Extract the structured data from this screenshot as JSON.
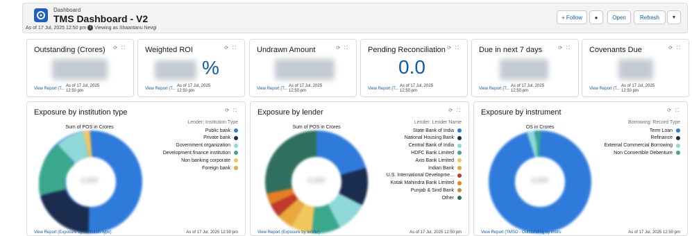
{
  "header": {
    "breadcrumb": "Dashboard",
    "title": "TMS Dashboard - V2",
    "as_of": "As of 17 Jul, 2025 12:50 pm",
    "viewing_as": "Viewing as Shaantanu Nevgi",
    "buttons": {
      "follow": "+ Follow",
      "open": "Open",
      "refresh": "Refresh"
    }
  },
  "kpis": [
    {
      "title": "Outstanding (Crores)",
      "value": "",
      "link": "View Report (T...",
      "as_of": "As of 17 Jul, 2025 12:50 pm"
    },
    {
      "title": "Weighted ROI",
      "value": "%",
      "link": "View Report (T...",
      "as_of": "As of 17 Jul, 2025 12:50 pm"
    },
    {
      "title": "Undrawn Amount",
      "value": "",
      "link": "View Report (T...",
      "as_of": "As of 17 Jul, 2025 12:50 pm"
    },
    {
      "title": "Pending Reconciliation",
      "value": "0.0",
      "link": "View Report (T...",
      "as_of": "As of 17 Jul, 2025 12:50 pm"
    },
    {
      "title": "Due in next 7 days",
      "value": "",
      "link": "View Report (T...",
      "as_of": "As of 17 Jul, 2025 12:50 pm"
    },
    {
      "title": "Covenants Due",
      "value": "",
      "link": "View Report (T...",
      "as_of": "As of 17 Jul, 2025 12:50 pm"
    }
  ],
  "charts": [
    {
      "title": "Exposure by institution type",
      "measure_label": "Sum of POS in Crores",
      "legend_title": "Lender: Institution Type",
      "legend": [
        {
          "label": "Public bank",
          "color": "#2e7bdc"
        },
        {
          "label": "Private bank",
          "color": "#1b2d4f"
        },
        {
          "label": "Government organization",
          "color": "#8fd8d8"
        },
        {
          "label": "Development finance institution",
          "color": "#3aa88c"
        },
        {
          "label": "Non banking corporate",
          "color": "#f2c75c"
        },
        {
          "label": "Foreign bank",
          "color": "#e8a83c"
        }
      ],
      "footer_link": "View Report (Exposure by institution type)",
      "footer_asof": "As of 17 Jul, 2025 12:50 pm"
    },
    {
      "title": "Exposure by lender",
      "measure_label": "Sum of POS in Crores",
      "legend_title": "Lender: Lender Name",
      "legend": [
        {
          "label": "State Bank of India",
          "color": "#2e7bdc"
        },
        {
          "label": "National Housing Bank",
          "color": "#1b2d4f"
        },
        {
          "label": "Central Bank of India",
          "color": "#8fd8d8"
        },
        {
          "label": "HDFC Bank Limited",
          "color": "#3aa88c"
        },
        {
          "label": "Axis Bank Limited",
          "color": "#f2c75c"
        },
        {
          "label": "Indian Bank",
          "color": "#e8a83c"
        },
        {
          "label": "U.S. International Developme...",
          "color": "#c0392b"
        },
        {
          "label": "Kotak Mahindra Bank Limited",
          "color": "#e67e22"
        },
        {
          "label": "Punjab & Sind Bank",
          "color": "#c58a3a"
        },
        {
          "label": "Other",
          "color": "#2f6f5e"
        }
      ],
      "footer_link": "View Report (Exposure by lender)",
      "footer_asof": "As of 17 Jul, 2025 12:50 pm"
    },
    {
      "title": "Exposure by instrument",
      "measure_label": "OS in Crores",
      "legend_title": "Borrowing: Record Type",
      "legend": [
        {
          "label": "Term Loan",
          "color": "#2e7bdc"
        },
        {
          "label": "Refinance",
          "color": "#1b2d4f"
        },
        {
          "label": "External Commercial Borrowing",
          "color": "#8fd8d8"
        },
        {
          "label": "Non Convertible Debenture",
          "color": "#3aa88c"
        }
      ],
      "footer_link": "View Report (TMSO - Outstanding by instru",
      "footer_asof": "As of 17 Jul, 2025 12:50 pm"
    }
  ]
}
